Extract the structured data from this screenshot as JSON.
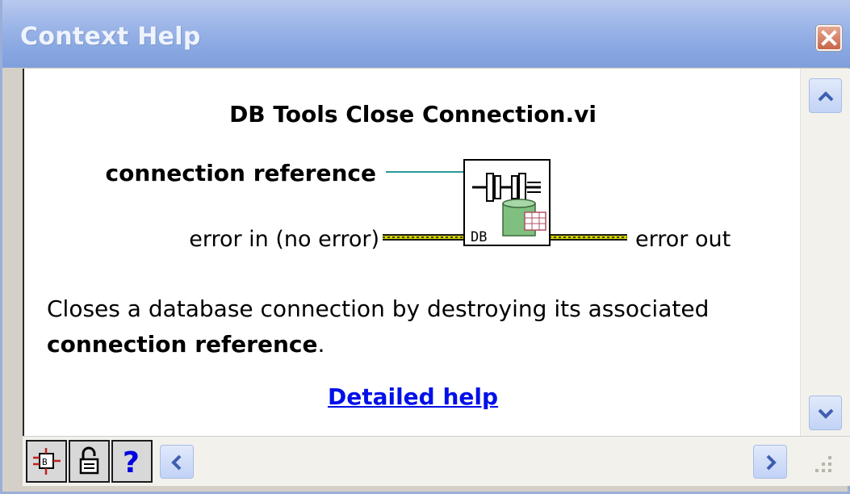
{
  "window": {
    "title": "Context Help",
    "close_icon": "close-icon",
    "colors": {
      "title_bar": "#9fb7e8",
      "close_button": "#c86549",
      "link": "#0010e8",
      "wire_teal": "#2a9a9a",
      "wire_error": "#c8c800"
    }
  },
  "help": {
    "vi_title": "DB Tools Close Connection.vi",
    "terminals": {
      "connection_reference": "connection reference",
      "error_in": "error in (no error)",
      "error_out": "error out"
    },
    "icon_label": "DB",
    "description_part1": "Closes a database connection by destroying its associated ",
    "description_bold": "connection reference",
    "description_part2": ".",
    "link": "Detailed help"
  },
  "toolbar": {
    "buttons": [
      {
        "name": "show-optional-terminals-button",
        "icon": "vi-terminals-icon"
      },
      {
        "name": "lock-button",
        "icon": "lock-icon"
      },
      {
        "name": "detailed-help-button",
        "icon": "question-icon",
        "glyph": "?"
      }
    ]
  },
  "scrollbars": {
    "vertical_up": "chevron-up-icon",
    "vertical_down": "chevron-down-icon",
    "horizontal_left": "chevron-left-icon",
    "horizontal_right": "chevron-right-icon",
    "resize": "resize-grip-icon"
  }
}
